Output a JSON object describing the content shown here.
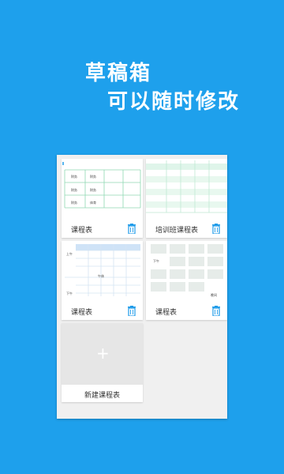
{
  "promo": {
    "line1": "草稿箱",
    "line2": "可以随时修改"
  },
  "cards": [
    {
      "label": "课程表",
      "cells": [
        "财务",
        "财务",
        "财务",
        "财务",
        "财务",
        "体育"
      ]
    },
    {
      "label": "培训班课程表"
    },
    {
      "label": "课程表",
      "side_top": "上午",
      "mid": "午休",
      "side_bottom": "下午"
    },
    {
      "label": "课程表",
      "left_tag": "下午",
      "bottom_tag": "晚间"
    }
  ],
  "new_card": {
    "label": "新建课程表",
    "plus": "+"
  },
  "colors": {
    "background": "#1ea0ec",
    "accent_trash": "#1e9be9",
    "table_green": "#8fd8b3",
    "table_blue": "#cfe3f7"
  }
}
